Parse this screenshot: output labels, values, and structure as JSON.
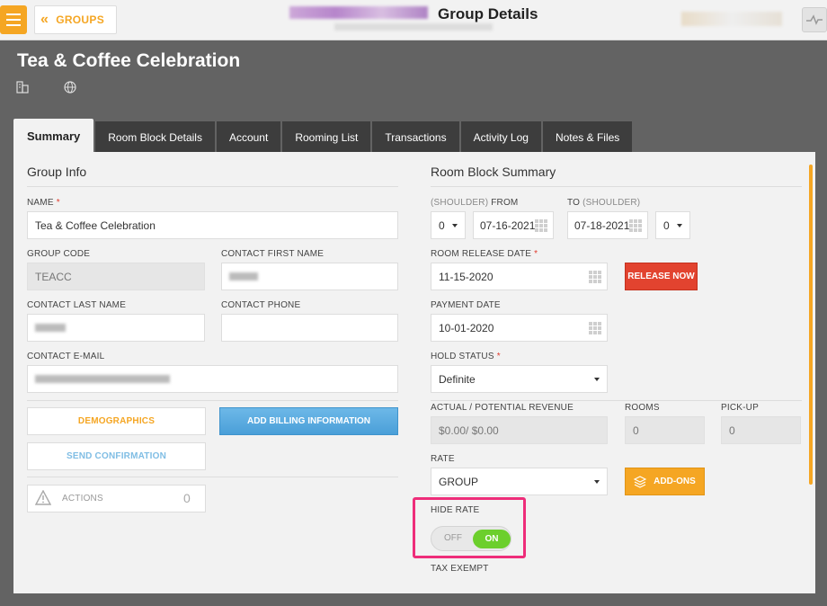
{
  "topbar": {
    "groups_label": "GROUPS",
    "title": "Group Details"
  },
  "header": {
    "group_name": "Tea & Coffee Celebration"
  },
  "tabs": [
    {
      "label": "Summary"
    },
    {
      "label": "Room Block Details"
    },
    {
      "label": "Account"
    },
    {
      "label": "Rooming List"
    },
    {
      "label": "Transactions"
    },
    {
      "label": "Activity Log"
    },
    {
      "label": "Notes & Files"
    }
  ],
  "group_info": {
    "title": "Group Info",
    "name_label": "NAME",
    "name_value": "Tea & Coffee Celebration",
    "group_code_label": "GROUP CODE",
    "group_code_value": "TEACC",
    "contact_first_name_label": "CONTACT FIRST NAME",
    "contact_last_name_label": "CONTACT LAST NAME",
    "contact_phone_label": "CONTACT PHONE",
    "contact_email_label": "CONTACT E-MAIL",
    "demographics_label": "DEMOGRAPHICS",
    "add_billing_label": "ADD BILLING INFORMATION",
    "send_confirmation_label": "SEND CONFIRMATION",
    "actions_label": "ACTIONS",
    "actions_count": "0"
  },
  "room_block": {
    "title": "Room Block Summary",
    "from_label_shoulder": "(SHOULDER)",
    "from_label": "FROM",
    "to_label": "TO",
    "to_label_shoulder": "(SHOULDER)",
    "shoulder_from_value": "0",
    "from_date": "07-16-2021",
    "to_date": "07-18-2021",
    "shoulder_to_value": "0",
    "release_date_label": "ROOM RELEASE DATE",
    "release_date": "11-15-2020",
    "release_now_label": "RELEASE NOW",
    "payment_date_label": "PAYMENT DATE",
    "payment_date": "10-01-2020",
    "hold_status_label": "HOLD STATUS",
    "hold_status_value": "Definite",
    "revenue_label": "ACTUAL / POTENTIAL REVENUE",
    "revenue_value": "$0.00/ $0.00",
    "rooms_label": "ROOMS",
    "rooms_value": "0",
    "pickup_label": "PICK-UP",
    "pickup_value": "0",
    "rate_label": "RATE",
    "rate_value": "GROUP",
    "addons_label": "ADD-ONS",
    "hide_rate_label": "HIDE RATE",
    "toggle_off": "OFF",
    "toggle_on": "ON",
    "tax_exempt_label": "TAX EXEMPT"
  },
  "colors": {
    "accent": "#f5a623",
    "danger": "#e2432f",
    "info": "#5aaee0",
    "success": "#6ccf2c",
    "highlight": "#ee2d7a"
  }
}
